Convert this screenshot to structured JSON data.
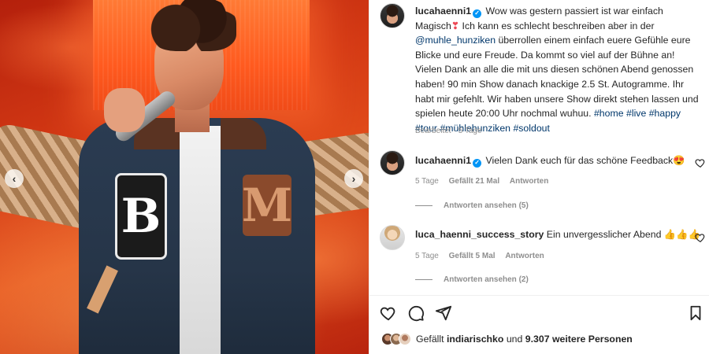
{
  "post": {
    "author": "lucahaenni1",
    "caption_part1": "Wow was gestern passiert ist war einfach Magisch",
    "caption_emoji": "❣",
    "caption_part2": "Ich kann es schlecht beschreiben aber in der",
    "mention": "@muhle_hunziken",
    "caption_part3": "überrollen einem einfach euere Gefühle eure Blicke und eure Freude. Da kommt so viel auf der Bühne an! Vielen Dank an alle die mit uns diesen schönen Abend genossen haben! 90 min Show danach knackige 2.5 St. Autogramme. Ihr habt mir gefehlt. Wir haben unsere Show direkt stehen lassen und spielen heute 20:00 Uhr nochmal wuhuu.",
    "hashtags": [
      "#home",
      "#live",
      "#happy",
      "#tour",
      "#mühlehunziken",
      "#soldout"
    ],
    "edited_label": "Bearbeitet",
    "age": "5 Tage"
  },
  "photo": {
    "patch_b_letter": "B",
    "patch_m_letter": "M",
    "prev_arrow": "‹",
    "next_arrow": "›"
  },
  "comments": [
    {
      "user": "lucahaenni1",
      "text": "Vielen Dank euch für das schöne Feedback",
      "emoji": "😍",
      "age": "5 Tage",
      "likes": "Gefällt 21 Mal",
      "reply": "Antworten",
      "view_replies": "Antworten ansehen (5)"
    },
    {
      "user": "luca_haenni_success_story",
      "text": "Ein unvergesslicher Abend",
      "emoji": "👍👍👍",
      "age": "5 Tage",
      "likes": "Gefällt 5 Mal",
      "reply": "Antworten",
      "view_replies": "Antworten ansehen (2)"
    }
  ],
  "likes_summary": {
    "prefix": "Gefällt",
    "first_user": "indiarischko",
    "connector": "und",
    "others": "9.307 weitere Personen"
  },
  "icons": {
    "like": "heart-icon",
    "comment": "comment-icon",
    "share": "share-icon",
    "save": "bookmark-icon",
    "verified": "verified-badge-icon"
  },
  "colors": {
    "link": "#00376b",
    "verified": "#0095f6",
    "muted": "#8e8e8e"
  }
}
